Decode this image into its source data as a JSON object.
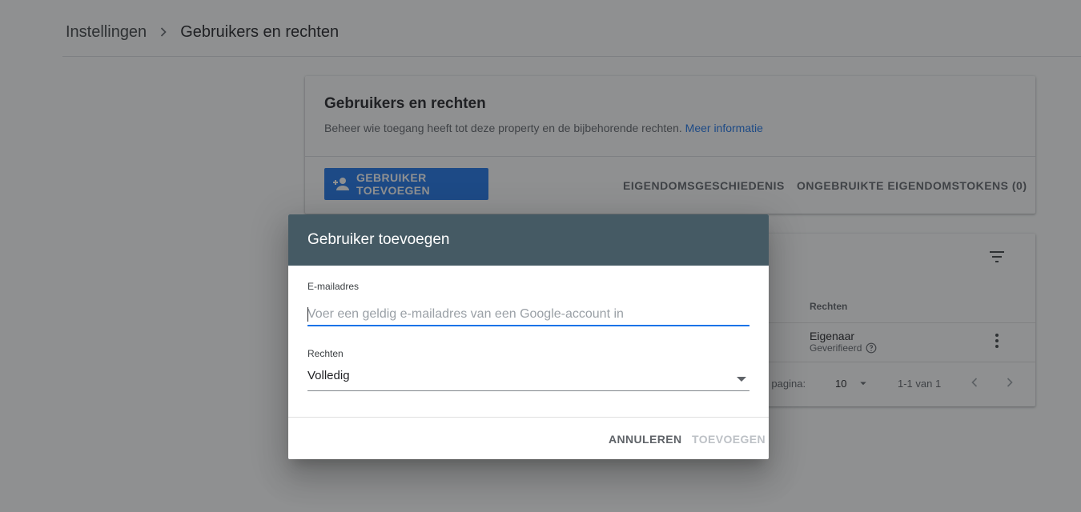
{
  "breadcrumb": {
    "parent": "Instellingen",
    "current": "Gebruikers en rechten"
  },
  "card": {
    "title": "Gebruikers en rechten",
    "description": "Beheer wie toegang heeft tot deze property en de bijbehorende rechten.",
    "more_info_link": "Meer informatie",
    "add_user_button": "GEBRUIKER TOEVOEGEN",
    "ownership_history_button": "EIGENDOMSGESCHIEDENIS",
    "unused_tokens_button": "ONGEBRUIKTE EIGENDOMSTOKENS (0)"
  },
  "table": {
    "column_permissions": "Rechten",
    "rows": [
      {
        "role": "Eigenaar",
        "status": "Geverifieerd"
      }
    ],
    "pagination": {
      "rows_per_page_label": "per pagina:",
      "rows_per_page_value": "10",
      "range": "1-1 van 1"
    }
  },
  "dialog": {
    "title": "Gebruiker toevoegen",
    "email_label": "E-mailadres",
    "email_value": "",
    "email_placeholder": "Voer een geldig e-mailadres van een Google-account in",
    "permissions_label": "Rechten",
    "permissions_value": "Volledig",
    "cancel_button": "ANNULEREN",
    "submit_button": "TOEVOEGEN"
  },
  "icons": {
    "breadcrumb_separator": "chevron-right-icon",
    "add_user": "person-add-icon",
    "filter": "filter-list-icon",
    "help": "help-outline-icon",
    "more": "more-vert-icon",
    "dropdown": "arrow-drop-down-icon",
    "prev": "chevron-left-icon",
    "next": "chevron-right-icon"
  },
  "colors": {
    "primary": "#1a73e8",
    "dialog_header": "#455a64",
    "scrim": "rgba(32,33,36,0.5)"
  }
}
